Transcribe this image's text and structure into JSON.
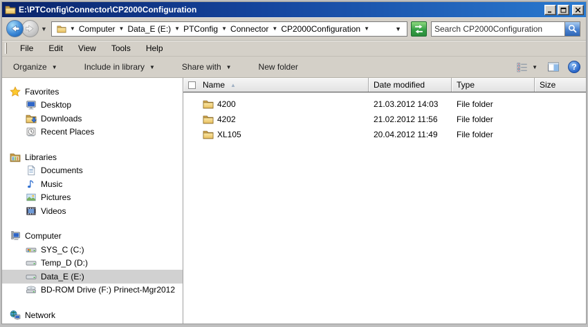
{
  "icons": {
    "dropdown_arrow": "▼",
    "sort_ascending": "▲",
    "help_glyph": "?"
  },
  "colors": {
    "titlebar_left": "#0a246a",
    "titlebar_right": "#2a7ad0",
    "chrome_gray": "#d4d0c8",
    "sidebar_selection": "#d1d1d1",
    "refresh_green": "#35a046",
    "search_blue": "#4a82cf",
    "folder_yellow": "#f2d376"
  },
  "window": {
    "title": "E:\\PTConfig\\Connector\\CP2000Configuration"
  },
  "address_bar": {
    "breadcrumbs": [
      {
        "label": "Computer"
      },
      {
        "label": "Data_E (E:)"
      },
      {
        "label": "PTConfig"
      },
      {
        "label": "Connector"
      },
      {
        "label": "CP2000Configuration"
      }
    ],
    "search": {
      "placeholder": "Search CP2000Configuration",
      "value": ""
    }
  },
  "menu_bar": {
    "items": [
      {
        "label": "File"
      },
      {
        "label": "Edit"
      },
      {
        "label": "View"
      },
      {
        "label": "Tools"
      },
      {
        "label": "Help"
      }
    ]
  },
  "toolbar": {
    "buttons": [
      {
        "label": "Organize",
        "dropdown": true
      },
      {
        "label": "Include in library",
        "dropdown": true
      },
      {
        "label": "Share with",
        "dropdown": true
      },
      {
        "label": "New folder",
        "dropdown": false
      }
    ]
  },
  "sidebar": {
    "sections": [
      {
        "label": "Favorites",
        "children": [
          {
            "label": "Desktop"
          },
          {
            "label": "Downloads"
          },
          {
            "label": "Recent Places"
          }
        ]
      },
      {
        "label": "Libraries",
        "children": [
          {
            "label": "Documents"
          },
          {
            "label": "Music"
          },
          {
            "label": "Pictures"
          },
          {
            "label": "Videos"
          }
        ]
      },
      {
        "label": "Computer",
        "children": [
          {
            "label": "SYS_C (C:)"
          },
          {
            "label": "Temp_D (D:)"
          },
          {
            "label": "Data_E (E:)",
            "selected": true
          },
          {
            "label": "BD-ROM Drive (F:) Prinect-Mgr2012"
          }
        ]
      },
      {
        "label": "Network",
        "children": []
      }
    ]
  },
  "file_list": {
    "columns": [
      {
        "label": "Name",
        "sort": "ascending"
      },
      {
        "label": "Date modified"
      },
      {
        "label": "Type"
      },
      {
        "label": "Size"
      }
    ],
    "rows": [
      {
        "name": "4200",
        "date_modified": "21.03.2012 14:03",
        "type": "File folder",
        "size": ""
      },
      {
        "name": "4202",
        "date_modified": "21.02.2012 11:56",
        "type": "File folder",
        "size": ""
      },
      {
        "name": "XL105",
        "date_modified": "20.04.2012 11:49",
        "type": "File folder",
        "size": ""
      }
    ]
  }
}
